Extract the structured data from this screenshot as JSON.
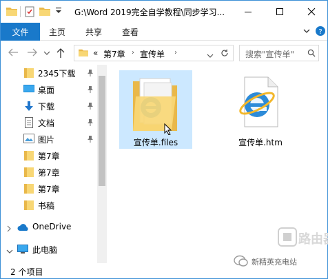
{
  "titlebar": {
    "path": "G:\\Word 2019完全自学教程\\同步学习..."
  },
  "ribbon": {
    "tabs": [
      "文件",
      "主页",
      "共享",
      "查看"
    ]
  },
  "address": {
    "overflow": "«",
    "crumbs": [
      "第7章",
      "宣传单"
    ],
    "search_placeholder": "搜索\"宣传单\""
  },
  "sidebar": {
    "items": [
      {
        "label": "2345下载",
        "icon": "folder-icon",
        "pinned": true
      },
      {
        "label": "桌面",
        "icon": "desktop-icon",
        "pinned": true
      },
      {
        "label": "下载",
        "icon": "download-icon",
        "pinned": true
      },
      {
        "label": "文档",
        "icon": "document-icon",
        "pinned": true
      },
      {
        "label": "图片",
        "icon": "pictures-icon",
        "pinned": true
      },
      {
        "label": "第7章",
        "icon": "folder-icon",
        "pinned": false
      },
      {
        "label": "第7章",
        "icon": "folder-icon",
        "pinned": false
      },
      {
        "label": "第7章",
        "icon": "folder-icon",
        "pinned": false
      },
      {
        "label": "书稿",
        "icon": "folder-icon",
        "pinned": false
      },
      {
        "label": "OneDrive",
        "icon": "onedrive-icon",
        "pinned": false
      },
      {
        "label": "此电脑",
        "icon": "this-pc-icon",
        "pinned": false
      }
    ]
  },
  "files": [
    {
      "name": "宣传单.files",
      "icon": "ie-folder-icon",
      "selected": true
    },
    {
      "name": "宣传单.htm",
      "icon": "ie-html-file-icon",
      "selected": false
    }
  ],
  "status": {
    "count_text": "2 个项目"
  },
  "watermark": {
    "brand": "路由器",
    "account": "新精英充电站"
  },
  "colors": {
    "accent": "#1979ca",
    "selection": "#cce8ff",
    "folder": "#f8d775"
  }
}
